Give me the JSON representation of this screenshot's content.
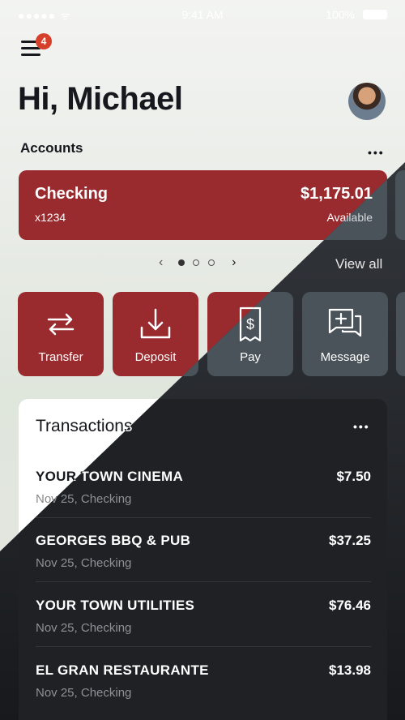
{
  "status": {
    "carrier": "●●●●● ᯤ",
    "time": "9:41 AM",
    "battery": "100%"
  },
  "header": {
    "notification_count": "4",
    "greeting": "Hi, Michael"
  },
  "accounts": {
    "label": "Accounts",
    "more": "•••",
    "card": {
      "name": "Checking",
      "number": "x1234",
      "balance": "$1,175.01",
      "status": "Available"
    },
    "pager": {
      "prev": "‹",
      "next": "›"
    },
    "view_all": "View all"
  },
  "actions": [
    {
      "label": "Transfer",
      "icon": "transfer-icon"
    },
    {
      "label": "Deposit",
      "icon": "deposit-icon"
    },
    {
      "label": "Pay",
      "icon": "pay-icon"
    },
    {
      "label": "Message",
      "icon": "message-icon"
    }
  ],
  "transactions": {
    "title": "Transactions",
    "more": "•••",
    "rows": [
      {
        "merchant": "YOUR TOWN CINEMA",
        "meta": "Nov 25, Checking",
        "amount": "$7.50"
      },
      {
        "merchant": "GEORGES BBQ & PUB",
        "meta": "Nov 25, Checking",
        "amount": "$37.25"
      },
      {
        "merchant": "YOUR TOWN UTILITIES",
        "meta": "Nov 25, Checking",
        "amount": "$76.46"
      },
      {
        "merchant": "EL GRAN RESTAURANTE",
        "meta": "Nov 25, Checking",
        "amount": "$13.98"
      }
    ]
  },
  "colors": {
    "brand_red": "#992a2e",
    "dark_tile": "#4a525a",
    "dark_panel": "#1f2125",
    "light_text": "#16181d",
    "muted_light": "#888888",
    "muted_dark": "#8d9096"
  }
}
